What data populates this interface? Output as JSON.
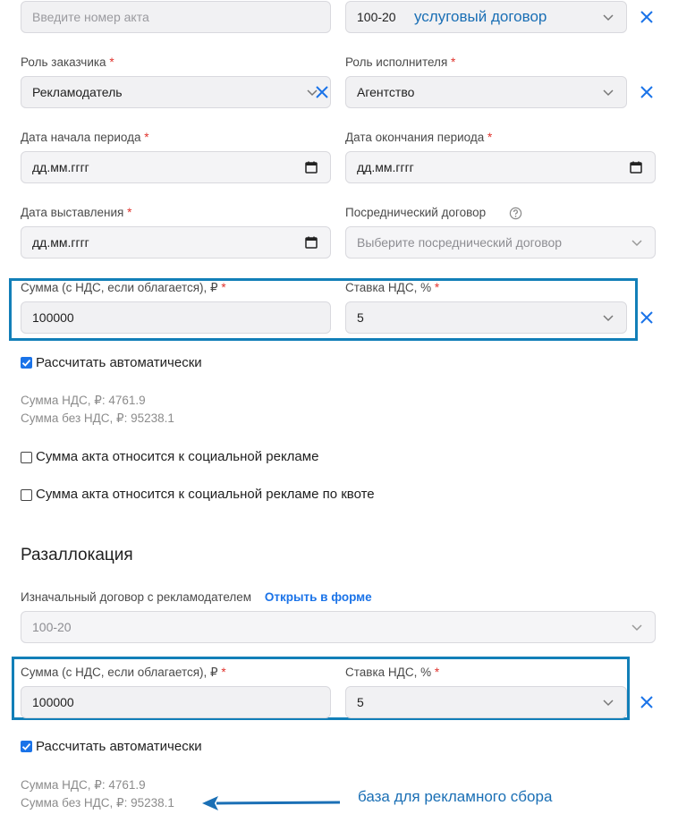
{
  "act": {
    "number_placeholder": "Введите номер акта",
    "contract_value": "100-20",
    "contract_annotation": "услуговый договор"
  },
  "roles": {
    "customer_label": "Роль заказчика",
    "customer_value": "Рекламодатель",
    "executor_label": "Роль исполнителя",
    "executor_value": "Агентство"
  },
  "dates": {
    "start_label": "Дата начала периода",
    "start_value": "дд.мм.гггг",
    "end_label": "Дата окончания периода",
    "end_value": "дд.мм.гггг",
    "issue_label": "Дата выставления",
    "issue_value": "дд.мм.гггг"
  },
  "intermediary": {
    "label": "Посреднический договор",
    "placeholder": "Выберите посреднический договор"
  },
  "amount": {
    "sum_label": "Сумма (с НДС, если облагается), ₽",
    "sum_value": "100000",
    "vat_label": "Ставка НДС, %",
    "vat_value": "5",
    "auto_label": "Рассчитать автоматически",
    "vat_sum": "Сумма НДС, ₽: 4761.9",
    "sum_no_vat": "Сумма без НДС, ₽: 95238.1"
  },
  "social": {
    "social_label": "Сумма акта относится к социальной рекламе",
    "quota_label": "Сумма акта относится к социальной рекламе по квоте"
  },
  "realloc": {
    "heading": "Разаллокация",
    "orig_label": "Изначальный договор с рекламодателем",
    "open_link": "Открыть в форме",
    "orig_value": "100-20",
    "sum_label": "Сумма (с НДС, если облагается), ₽",
    "sum_value": "100000",
    "vat_label": "Ставка НДС, %",
    "vat_value": "5",
    "auto_label": "Рассчитать автоматически",
    "vat_sum": "Сумма НДС, ₽: 4761.9",
    "sum_no_vat": "Сумма без НДС, ₽: 95238.1",
    "base_annotation": "база для рекламного сбора"
  },
  "common": {
    "required_mark": "*"
  },
  "colors": {
    "accent": "#1a73e8",
    "highlight": "#127fb8",
    "required": "#e0332d"
  }
}
